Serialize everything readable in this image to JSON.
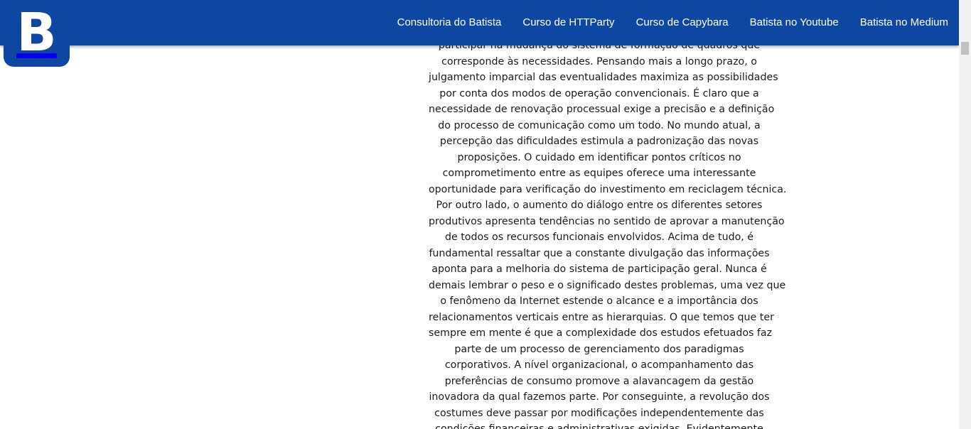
{
  "logo": {
    "letter": "B"
  },
  "nav": {
    "items": [
      {
        "label": "Consultoria do Batista"
      },
      {
        "label": "Curso de HTTParty"
      },
      {
        "label": "Curso de Capybara"
      },
      {
        "label": "Batista no Youtube"
      },
      {
        "label": "Batista no Medium"
      }
    ]
  },
  "article": {
    "lines": [
      "participar na mudança do sistema de formação de quadros que",
      "corresponde às necessidades. Pensando mais a longo prazo, o",
      "julgamento imparcial das eventualidades maximiza as possibilidades",
      "por conta dos modos de operação convencionais. É claro que a",
      "necessidade de renovação processual exige a precisão e a definição",
      "do processo de comunicação como um todo. No mundo atual, a",
      "percepção das dificuldades estimula a padronização das novas",
      "proposições. O cuidado em identificar pontos críticos no",
      "comprometimento entre as equipes oferece uma interessante",
      "oportunidade para verificação do investimento em reciclagem técnica.",
      "Por outro lado, o aumento do diálogo entre os diferentes setores",
      "produtivos apresenta tendências no sentido de aprovar a manutenção",
      "de todos os recursos funcionais envolvidos. Acima de tudo, é",
      "fundamental ressaltar que a constante divulgação das informações",
      "aponta para a melhoria do sistema de participação geral. Nunca é",
      "demais lembrar o peso e o significado destes problemas, uma vez que",
      "o fenômeno da Internet estende o alcance e a importância dos",
      "relacionamentos verticais entre as hierarquias. O que temos que ter",
      "sempre em mente é que a complexidade dos estudos efetuados faz",
      "parte de um processo de gerenciamento dos paradigmas",
      "corporativos. A nível organizacional, o acompanhamento das",
      "preferências de consumo promove a alavancagem da gestão",
      "inovadora da qual fazemos parte. Por conseguinte, a revolução dos",
      "costumes deve passar por modificações independentemente das",
      "condições financeiras e administrativas exigidas. Evidentemente"
    ]
  },
  "colors": {
    "navbar": "#0d47a1",
    "nav_text": "#ffffff",
    "body_text": "#1a1a1a"
  }
}
